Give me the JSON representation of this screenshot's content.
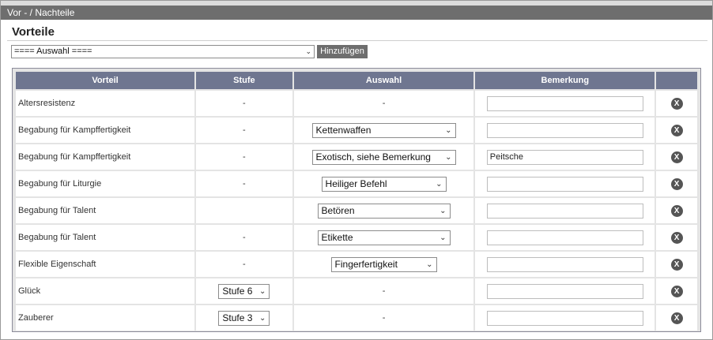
{
  "window": {
    "title": "Vor - / Nachteile"
  },
  "section": {
    "title": "Vorteile"
  },
  "toolbar": {
    "select_value": "==== Auswahl ====",
    "add_label": "Hinzufügen"
  },
  "table": {
    "headers": [
      "Vorteil",
      "Stufe",
      "Auswahl",
      "Bemerkung",
      ""
    ],
    "rows": [
      {
        "name": "Altersresistenz",
        "stufe": "-",
        "stufe_select": false,
        "auswahl": "-",
        "auswahl_select": false,
        "bemerkung": ""
      },
      {
        "name": "Begabung für Kampffertigkeit",
        "stufe": "-",
        "stufe_select": false,
        "auswahl": "Kettenwaffen",
        "auswahl_select": true,
        "bemerkung": ""
      },
      {
        "name": "Begabung für Kampffertigkeit",
        "stufe": "-",
        "stufe_select": false,
        "auswahl": "Exotisch, siehe Bemerkung",
        "auswahl_select": true,
        "bemerkung": "Peitsche"
      },
      {
        "name": "Begabung für Liturgie",
        "stufe": "-",
        "stufe_select": false,
        "auswahl": "Heiliger Befehl",
        "auswahl_select": true,
        "bemerkung": ""
      },
      {
        "name": "Begabung für Talent",
        "stufe": "",
        "stufe_select": false,
        "auswahl": "Betören",
        "auswahl_select": true,
        "bemerkung": ""
      },
      {
        "name": "Begabung für Talent",
        "stufe": "-",
        "stufe_select": false,
        "auswahl": "Etikette",
        "auswahl_select": true,
        "bemerkung": ""
      },
      {
        "name": "Flexible Eigenschaft",
        "stufe": "-",
        "stufe_select": false,
        "auswahl": "Fingerfertigkeit",
        "auswahl_select": true,
        "bemerkung": ""
      },
      {
        "name": "Glück",
        "stufe": "Stufe 6",
        "stufe_select": true,
        "auswahl": "-",
        "auswahl_select": false,
        "bemerkung": ""
      },
      {
        "name": "Zauberer",
        "stufe": "Stufe 3",
        "stufe_select": true,
        "auswahl": "-",
        "auswahl_select": false,
        "bemerkung": ""
      }
    ]
  },
  "icons": {
    "remove": "close-circle-icon",
    "dropdown": "chevron-down-icon"
  },
  "colors": {
    "titlebar": "#6e6e6e",
    "header": "#6f7690",
    "accent_button": "#6e6e6e"
  }
}
